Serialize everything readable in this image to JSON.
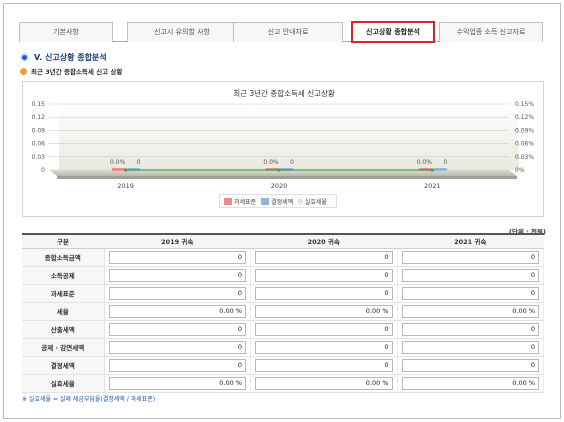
{
  "tabs": [
    {
      "label": "기본사항"
    },
    {
      "label": "신고시 유의할 사항"
    },
    {
      "label": "신고 안내자료"
    },
    {
      "label": "신고상황 종합분석"
    },
    {
      "label": "수익업종 소득 신고자료"
    }
  ],
  "active_tab": 3,
  "section": {
    "title": "V. 신고상황 종합분석",
    "subtitle": "최근 3년간 종합소득세 신고 상황"
  },
  "chart_data": {
    "type": "bar",
    "title": "최근 3년간 종합소득세 신고상황",
    "categories": [
      "2019",
      "2020",
      "2021"
    ],
    "left_axis_ticks": [
      "0.15",
      "0.12",
      "0.09",
      "0.06",
      "0.03",
      "0"
    ],
    "right_axis_ticks": [
      "0.15%",
      "0.12%",
      "0.09%",
      "0.06%",
      "0.03%",
      "0%"
    ],
    "ylim": [
      0,
      0.15
    ],
    "series": [
      {
        "name": "과세표준",
        "values": [
          0,
          0,
          0
        ],
        "color": "#e88a8a"
      },
      {
        "name": "결정세액",
        "values": [
          0,
          0,
          0
        ],
        "color": "#8fb4e3"
      },
      {
        "name": "실효세율",
        "values": [
          0,
          0,
          0
        ],
        "color": "#3aa84a"
      }
    ],
    "point_labels": [
      {
        "rate": "0.0%",
        "value": "0"
      },
      {
        "rate": "0.0%",
        "value": "0"
      },
      {
        "rate": "0.0%",
        "value": "0"
      }
    ]
  },
  "table": {
    "unit": "(단위 : 천원)",
    "headers": [
      "구분",
      "2019 귀속",
      "2020 귀속",
      "2021 귀속"
    ],
    "rows": [
      {
        "label": "종합소득금액",
        "values": [
          "0",
          "0",
          "0"
        ]
      },
      {
        "label": "소득공제",
        "values": [
          "0",
          "0",
          "0"
        ]
      },
      {
        "label": "과세표준",
        "values": [
          "0",
          "0",
          "0"
        ]
      },
      {
        "label": "세율",
        "values": [
          "0.00 %",
          "0.00 %",
          "0.00 %"
        ]
      },
      {
        "label": "산출세액",
        "values": [
          "0",
          "0",
          "0"
        ]
      },
      {
        "label": "공제 · 감면세액",
        "values": [
          "0",
          "0",
          "0"
        ]
      },
      {
        "label": "결정세액",
        "values": [
          "0",
          "0",
          "0"
        ]
      },
      {
        "label": "실효세율",
        "values": [
          "0.00 %",
          "0.00 %",
          "0.00 %"
        ]
      }
    ]
  },
  "footnote": "※ 실효세율 = 실제 세금부담율(결정세액 / 과세표준)"
}
